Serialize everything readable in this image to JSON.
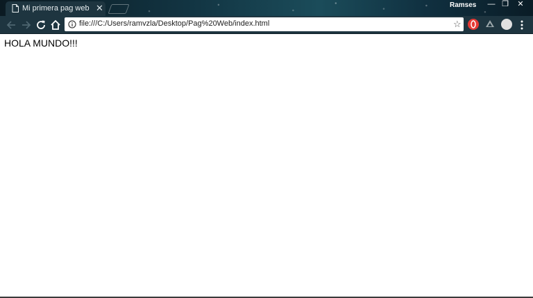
{
  "window": {
    "profile_name": "Ramses",
    "minimize_glyph": "—",
    "restore_glyph": "❐",
    "close_glyph": "✕"
  },
  "tabs": [
    {
      "title": "Mi primera pag web",
      "close_glyph": "✕",
      "active": true
    }
  ],
  "toolbar": {
    "url": "file:///C:/Users/ramvzla/Desktop/Pag%20Web/index.html",
    "star_glyph": "☆",
    "menu_glyph": "⋮",
    "icons": [
      "back-arrow-icon",
      "forward-arrow-icon",
      "reload-icon",
      "home-icon",
      "info-icon",
      "star-icon",
      "extension-icon",
      "drive-icon",
      "profile-extension-icon",
      "menu-icon"
    ]
  },
  "page": {
    "text": "HOLA MUNDO!!!"
  },
  "colors": {
    "toolbar": "#1e3540",
    "page_background": "#ffffff",
    "text": "#000000"
  }
}
